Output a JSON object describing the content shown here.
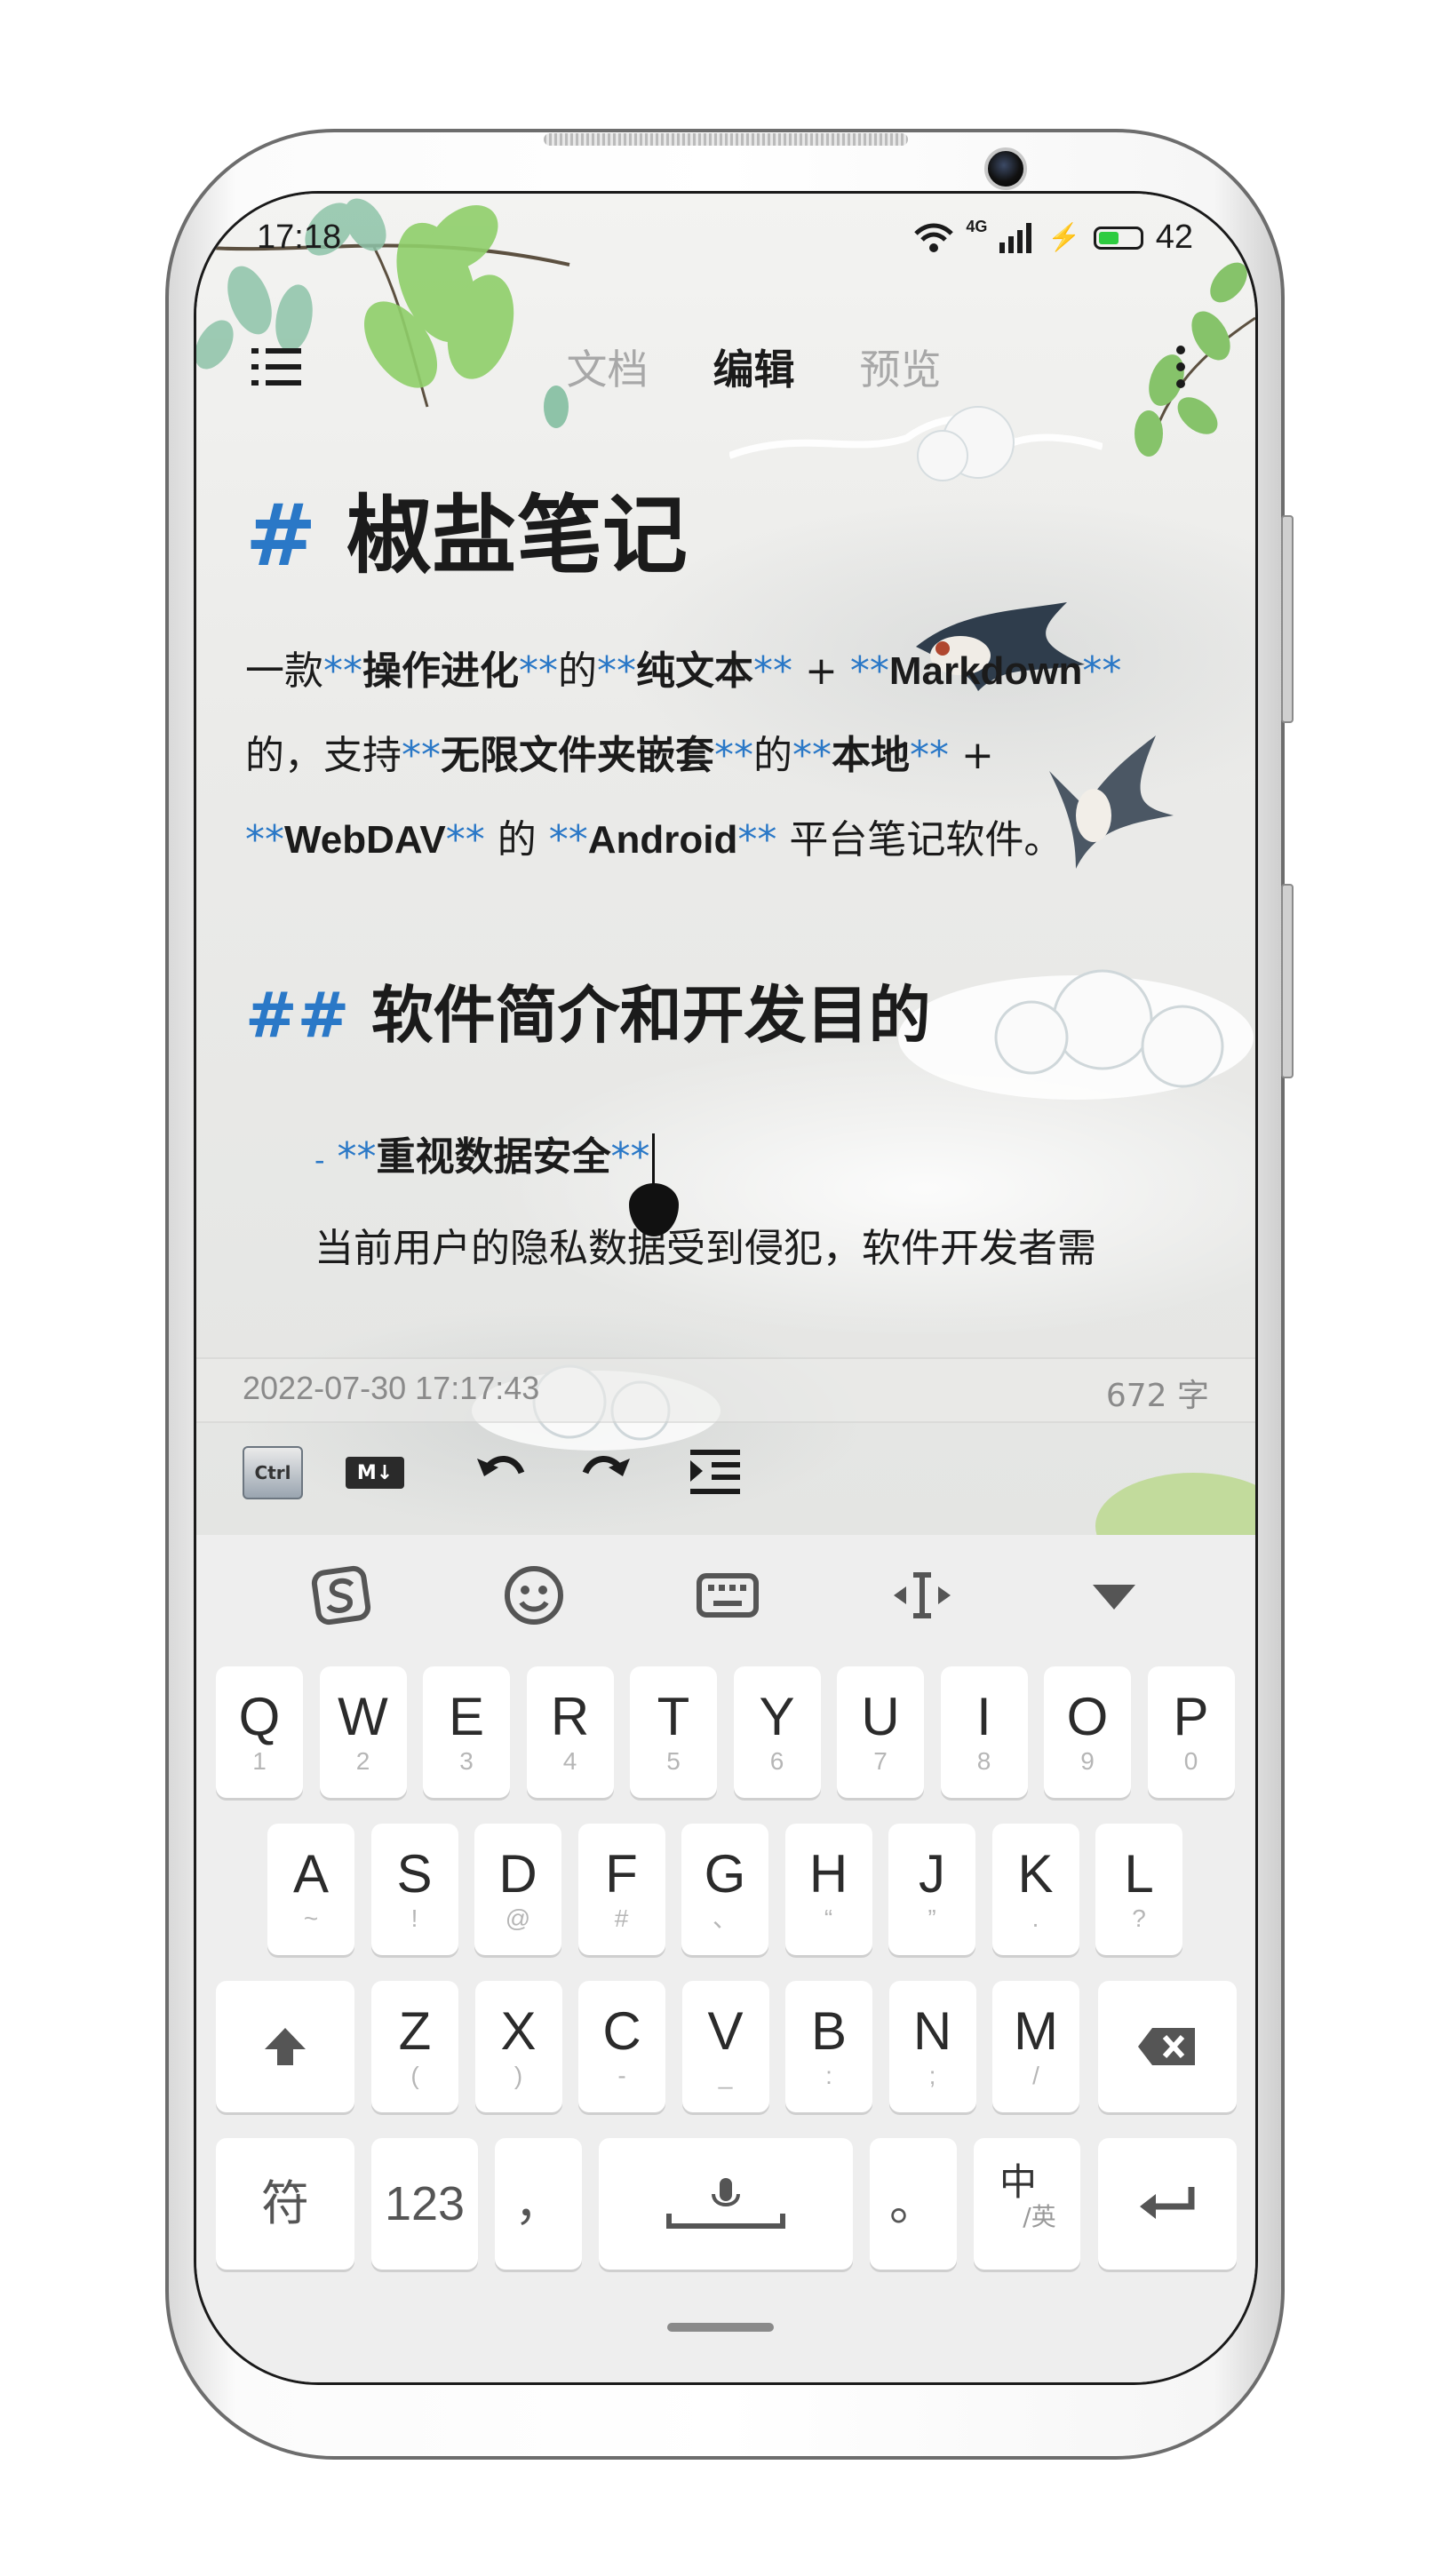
{
  "status": {
    "time": "17:18",
    "network": "4G",
    "battery": "42"
  },
  "topbar": {
    "tabs": [
      {
        "label": "文档"
      },
      {
        "label": "编辑"
      },
      {
        "label": "预览"
      }
    ],
    "active_tab": "编辑"
  },
  "editor": {
    "h1_mark": "#",
    "h1_text": "椒盐笔记",
    "para": {
      "p1": "一款",
      "b1": "操作进化",
      "p2": "的",
      "b2": "纯文本",
      "p3": " + ",
      "b3": "Markdown",
      "p4": "的，支持",
      "b4": "无限文件夹嵌套",
      "p5": "的",
      "b5": "本地",
      "p6": " + ",
      "b6": "WebDAV",
      "p7": " 的 ",
      "b7": "Android",
      "p8": " 平台笔记软件。",
      "stars": "**"
    },
    "h2_mark": "##",
    "h2_text": "软件简介和开发目的",
    "list_dash": "-",
    "list_bold": "重视数据安全",
    "list_body": "当前用户的隐私数据受到侵犯，软件开发者需"
  },
  "meta": {
    "date": "2022-07-30 17:17:43",
    "count": "672 字"
  },
  "toolbar": {
    "ctrl": "Ctrl",
    "md": "M↓"
  },
  "keyboard": {
    "row1": [
      {
        "k": "Q",
        "s": "1"
      },
      {
        "k": "W",
        "s": "2"
      },
      {
        "k": "E",
        "s": "3"
      },
      {
        "k": "R",
        "s": "4"
      },
      {
        "k": "T",
        "s": "5"
      },
      {
        "k": "Y",
        "s": "6"
      },
      {
        "k": "U",
        "s": "7"
      },
      {
        "k": "I",
        "s": "8"
      },
      {
        "k": "O",
        "s": "9"
      },
      {
        "k": "P",
        "s": "0"
      }
    ],
    "row2": [
      {
        "k": "A",
        "s": "~"
      },
      {
        "k": "S",
        "s": "!"
      },
      {
        "k": "D",
        "s": "@"
      },
      {
        "k": "F",
        "s": "#"
      },
      {
        "k": "G",
        "s": "、"
      },
      {
        "k": "H",
        "s": "“"
      },
      {
        "k": "J",
        "s": "”"
      },
      {
        "k": "K",
        "s": "."
      },
      {
        "k": "L",
        "s": "?"
      }
    ],
    "row3": [
      {
        "k": "Z",
        "s": "("
      },
      {
        "k": "X",
        "s": ")"
      },
      {
        "k": "C",
        "s": "-"
      },
      {
        "k": "V",
        "s": "_"
      },
      {
        "k": "B",
        "s": ":"
      },
      {
        "k": "N",
        "s": ";"
      },
      {
        "k": "M",
        "s": "/"
      }
    ],
    "symbols": "符",
    "numbers": "123",
    "comma": "，",
    "period": "。",
    "lang_main": "中",
    "lang_sub": "/英"
  }
}
